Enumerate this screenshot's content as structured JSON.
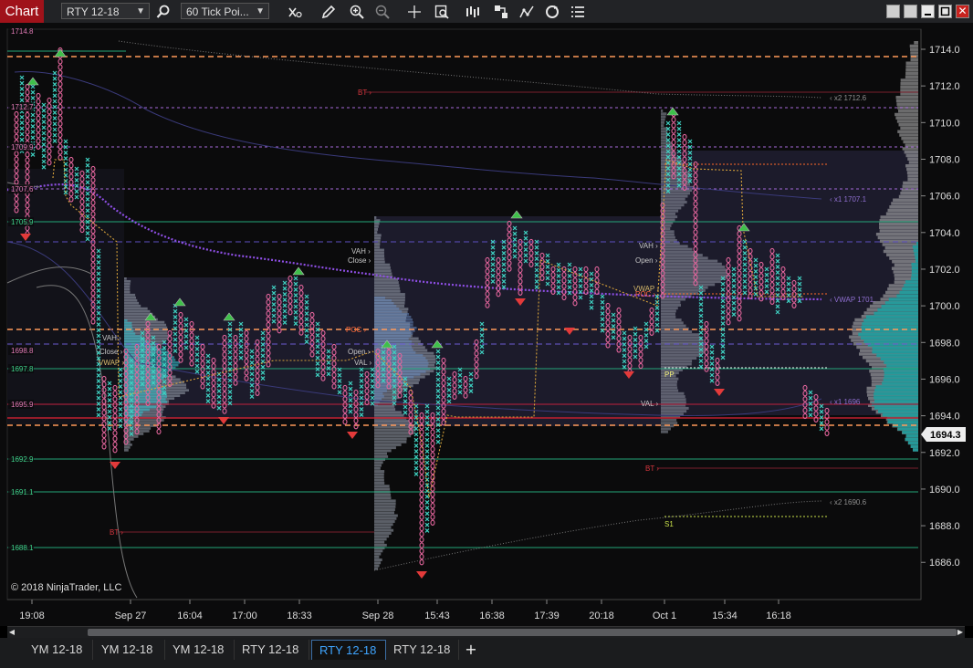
{
  "toolbar": {
    "chart_label": "Chart",
    "instrument_value": "RTY 12-18",
    "interval_value": "60 Tick Poi...",
    "icons": [
      "search-icon",
      "data-series-icon",
      "pencil-icon",
      "zoom-in-icon",
      "zoom-out-icon",
      "crosshair-icon",
      "data-box-icon",
      "bar-spacing-icon",
      "strategies-icon",
      "indicators-icon",
      "refresh-icon",
      "properties-icon"
    ]
  },
  "window_controls": [
    "minimize-icon",
    "restore-icon",
    "maximize-icon",
    "close-icon"
  ],
  "chart": {
    "copyright": "© 2018 NinjaTrader, LLC",
    "last_price": "1694.3",
    "y_ticks": [
      "1714.0",
      "1712.0",
      "1710.0",
      "1708.0",
      "1706.0",
      "1704.0",
      "1702.0",
      "1700.0",
      "1698.0",
      "1696.0",
      "1694.0",
      "1692.0",
      "1690.0",
      "1688.0",
      "1686.0"
    ],
    "x_ticks": [
      "19:08",
      "Sep 27",
      "16:04",
      "17:00",
      "18:33",
      "Sep 28",
      "15:43",
      "16:38",
      "17:39",
      "20:18",
      "Oct 1",
      "15:34",
      "16:18"
    ],
    "left_levels": [
      "1714.8",
      "1712.7",
      "1709.9",
      "1707.6",
      "1705.9",
      "1698.8",
      "1697.8",
      "1695.9",
      "1692.9",
      "1691.1",
      "1688.1"
    ],
    "session_labels": {
      "vah": "VAH ›",
      "close": "Close ›",
      "vwap": "VWAP ›",
      "val": "VAL ›",
      "poc": "POC ›",
      "open": "Open ›",
      "bt": "BT ›",
      "x2_upper": "‹ x2 1712.6",
      "x1_upper": "‹ x1 1707.1",
      "vwap_right": "‹ VWAP 1701.",
      "x1_lower": "‹ x1 1696",
      "x2_lower": "‹ x2 1690.6",
      "pp": "PP",
      "s1": "S1"
    },
    "colors": {
      "bg": "#0b0b0c",
      "xs": "#3fd1c2",
      "os": "#e3659c",
      "orange_dash": "#ff9a5a",
      "green_line": "#23a578",
      "purple_dash": "#a56ad8",
      "vwap_dot": "#8f4fe6",
      "profile": "#9fa6b3",
      "profile_teal": "#1aa0a0"
    }
  },
  "tabs": [
    {
      "label": "YM 12-18",
      "active": false
    },
    {
      "label": "YM 12-18",
      "active": false
    },
    {
      "label": "YM 12-18",
      "active": false
    },
    {
      "label": "RTY 12-18",
      "active": false
    },
    {
      "label": "RTY 12-18",
      "active": true
    },
    {
      "label": "RTY 12-18",
      "active": false
    }
  ],
  "add_tab_label": "+"
}
